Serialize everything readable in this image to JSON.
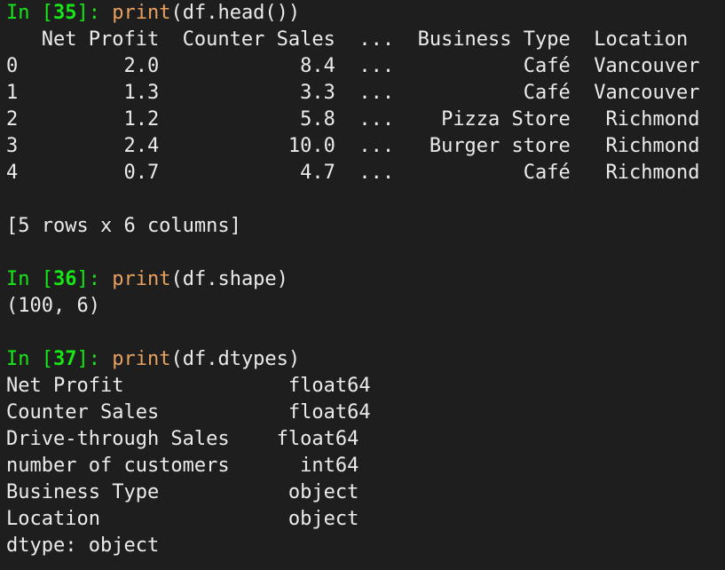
{
  "cells": [
    {
      "prompt_prefix": "In [",
      "exec_count": "35",
      "prompt_suffix": "]: ",
      "code_fn": "print",
      "code_args": "(df.head())",
      "output": [
        "   Net Profit  Counter Sales  ...  Business Type  Location",
        "0         2.0            8.4  ...           Café  Vancouver",
        "1         1.3            3.3  ...           Café  Vancouver",
        "2         1.2            5.8  ...    Pizza Store   Richmond",
        "3         2.4           10.0  ...   Burger store   Richmond",
        "4         0.7            4.7  ...           Café   Richmond",
        "",
        "[5 rows x 6 columns]"
      ]
    },
    {
      "prompt_prefix": "In [",
      "exec_count": "36",
      "prompt_suffix": "]: ",
      "code_fn": "print",
      "code_args": "(df.shape)",
      "output": [
        "(100, 6)"
      ]
    },
    {
      "prompt_prefix": "In [",
      "exec_count": "37",
      "prompt_suffix": "]: ",
      "code_fn": "print",
      "code_args": "(df.dtypes)",
      "output": [
        "Net Profit              float64",
        "Counter Sales           float64",
        "Drive-through Sales    float64",
        "number of customers      int64",
        "Business Type           object",
        "Location                object",
        "dtype: object"
      ]
    }
  ],
  "colors": {
    "background": "#1e1e1e",
    "prompt": "#17e617",
    "function": "#e8a060",
    "text": "#ebebeb"
  }
}
